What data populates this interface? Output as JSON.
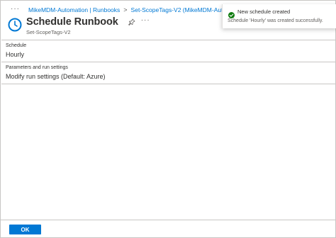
{
  "breadcrumb": {
    "more": "···",
    "items": [
      "MikeMDM-Automation | Runbooks",
      "Set-ScopeTags-V2 (MikeMDM-Automation"
    ],
    "separator": ">"
  },
  "header": {
    "icon": "clock-icon",
    "title": "Schedule Runbook",
    "subtitle": "Set-ScopeTags-V2",
    "pin_icon": "pin-icon",
    "more": "···"
  },
  "fields": {
    "schedule": {
      "label": "Schedule",
      "value": "Hourly"
    },
    "parameters": {
      "label": "Parameters and run settings",
      "value": "Modify run settings (Default: Azure)"
    }
  },
  "footer": {
    "ok_label": "OK"
  },
  "toast": {
    "icon": "checkmark-circle-icon",
    "title": "New schedule created",
    "message": "Schedule 'Hourly' was created successfully."
  },
  "colors": {
    "accent": "#0078d4",
    "success": "#107c10",
    "border": "#c8c6c4",
    "text": "#323130",
    "muted_text": "#605e5c"
  }
}
